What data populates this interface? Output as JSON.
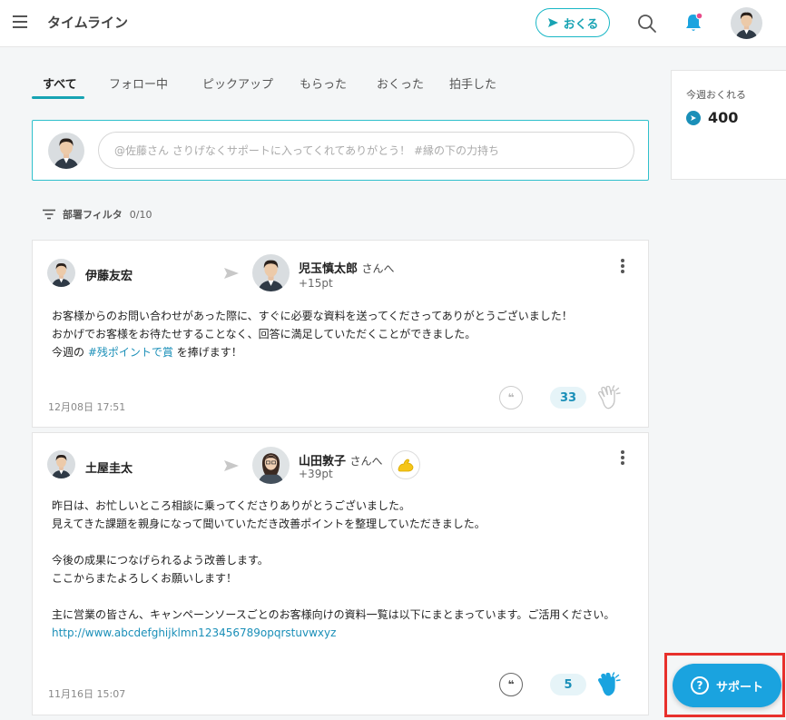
{
  "header": {
    "title": "タイムライン",
    "send_label": "おくる"
  },
  "tabs": [
    {
      "label": "すべて"
    },
    {
      "label": "フォロー中"
    },
    {
      "label": "ピックアップ"
    },
    {
      "label": "もらった"
    },
    {
      "label": "おくった"
    },
    {
      "label": "拍手した"
    }
  ],
  "compose": {
    "placeholder": "@佐藤さん さりげなくサポートに入ってくれてありがとう！ #縁の下の力持ち"
  },
  "filter": {
    "label": "部署フィルタ",
    "count": "0/10"
  },
  "posts": [
    {
      "sender": "伊藤友宏",
      "recipient": "児玉慎太郎",
      "recipient_suffix": "さんへ",
      "points": "+15pt",
      "message_lines": [
        "お客様からのお問い合わせがあった際に、すぐに必要な資料を送ってくださってありがとうございました！",
        "おかげでお客様をお待たせすることなく、回答に満足していただくことができました。"
      ],
      "line3_prefix": "今週の ",
      "hashtag": "#残ポイントで賞",
      "line3_suffix": " を捧げます！",
      "timestamp": "12月08日 17:51",
      "clap_count": "33"
    },
    {
      "sender": "土屋圭太",
      "recipient": "山田敦子",
      "recipient_suffix": "さんへ",
      "points": "+39pt",
      "message_lines": [
        "昨日は、お忙しいところ相談に乗ってくださりありがとうございました。",
        "見えてきた課題を親身になって聞いていただき改善ポイントを整理していただきました。",
        "",
        "今後の成果につなげられるよう改善します。",
        "ここからまたよろしくお願いします！",
        "",
        "主に営業の皆さん、キャンペーンソースごとのお客様向けの資料一覧は以下にまとまっています。ご活用ください。"
      ],
      "link": "http://www.abcdefghijklmn123456789opqrstuvwxyz",
      "timestamp": "11月16日 15:07",
      "clap_count": "5"
    }
  ],
  "side": {
    "label": "今週おくれる",
    "value": "400"
  },
  "support": {
    "label": "サポート",
    "icon_text": "?"
  },
  "colors": {
    "accent": "#17a3b3",
    "link": "#1a8fb8",
    "support": "#1aa3df",
    "highlight_frame": "#e8302c",
    "notification_dot": "#e84c8a"
  }
}
